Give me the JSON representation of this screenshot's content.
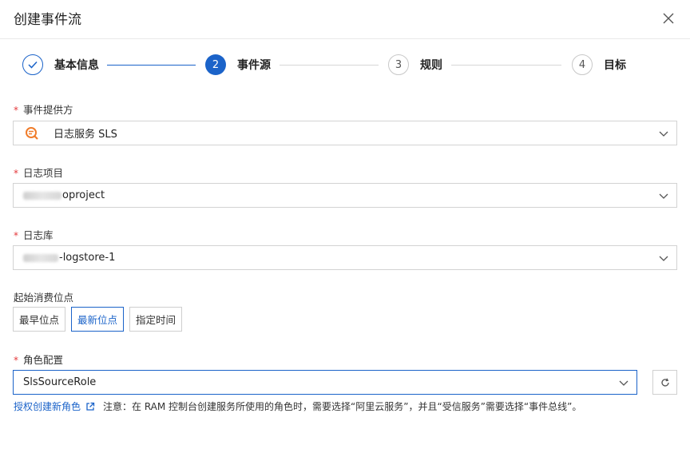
{
  "dialog": {
    "title": "创建事件流"
  },
  "steps": [
    {
      "number": "1",
      "label": "基本信息",
      "state": "done"
    },
    {
      "number": "2",
      "label": "事件源",
      "state": "active"
    },
    {
      "number": "3",
      "label": "规则",
      "state": "todo"
    },
    {
      "number": "4",
      "label": "目标",
      "state": "todo"
    }
  ],
  "fields": {
    "provider": {
      "label": "事件提供方",
      "required": "*",
      "value": "日志服务 SLS",
      "icon": "sls-logo-icon"
    },
    "project": {
      "label": "日志项目",
      "required": "*",
      "value_suffix": "oproject"
    },
    "logstore": {
      "label": "日志库",
      "required": "*",
      "value_suffix": "-logstore-1"
    },
    "start_position": {
      "label": "起始消费位点",
      "options": [
        "最早位点",
        "最新位点",
        "指定时间"
      ],
      "selected": "最新位点"
    },
    "role": {
      "label": "角色配置",
      "required": "*",
      "value": "SlsSourceRole"
    }
  },
  "hint": {
    "link_text": "授权创建新角色",
    "note": "注意：在 RAM 控制台创建服务所使用的角色时，需要选择“阿里云服务”，并且“受信服务”需要选择“事件总线”。"
  },
  "colors": {
    "primary": "#1b63c9",
    "required": "#e4393c",
    "border": "#d3d3d3",
    "sls_orange": "#f07c2a"
  }
}
